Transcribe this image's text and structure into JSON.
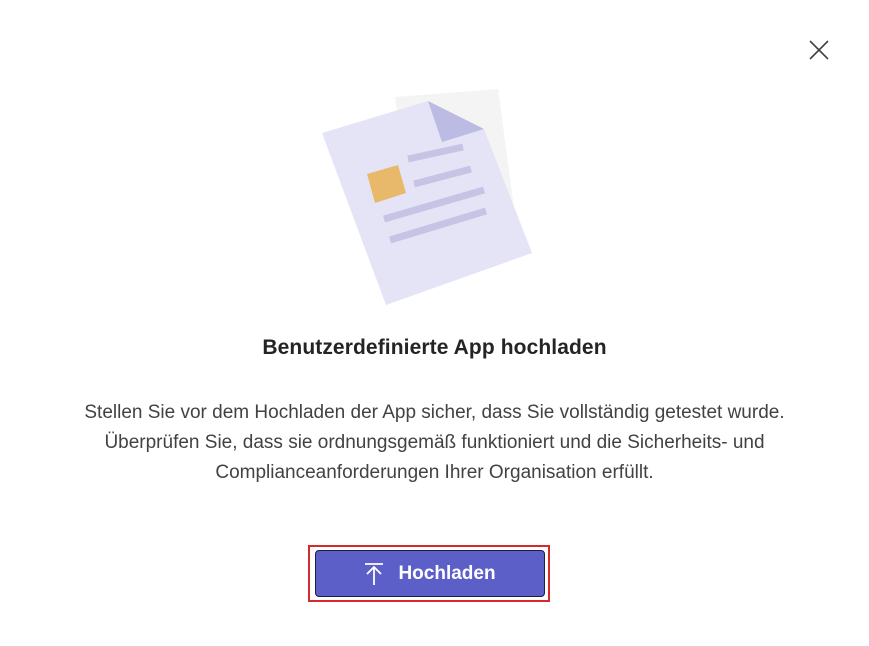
{
  "dialog": {
    "close_icon": "close-icon",
    "illustration_icon": "document-illustration",
    "title": "Benutzerdefinierte App hochladen",
    "description_lines": [
      "Stellen Sie vor dem Hochladen der App sicher, dass Sie vollständig getestet wurde.",
      "Überprüfen Sie, dass sie ordnungsgemäß funktioniert und die Sicherheits- und",
      "Complianceanforderungen Ihrer Organisation erfüllt."
    ],
    "upload_button": {
      "label": "Hochladen",
      "icon": "upload-arrow-icon"
    }
  },
  "colors": {
    "button": "#5b5fc7",
    "highlight": "#d42a2a",
    "paper": "#e5e4f6",
    "paper_lines": "#c5c4e4",
    "paper_fold": "#bcbbe4",
    "thumbnail": "#e8b96a",
    "backdrop": "#f4f4f4"
  }
}
